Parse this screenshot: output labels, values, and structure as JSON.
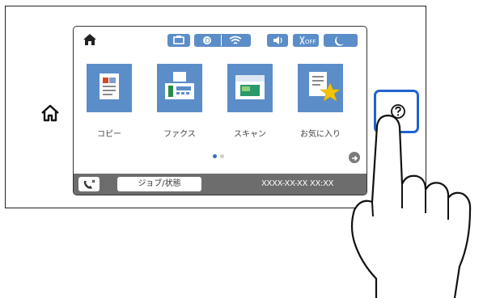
{
  "panel": {
    "home_button_icon": "home-outline-icon",
    "help_button_icon": "question-circle-icon",
    "help_button_highlight_color": "#1f63d2"
  },
  "screen": {
    "status_icons": [
      "home-icon",
      "copy-status-icon",
      "wifi-direct-icon",
      "wifi-icon",
      "volume-icon",
      "eco-off-icon",
      "sleep-icon"
    ],
    "tiles": [
      {
        "label": "コピー",
        "icon": "copy-icon"
      },
      {
        "label": "ファクス",
        "icon": "fax-icon"
      },
      {
        "label": "スキャン",
        "icon": "scan-icon"
      },
      {
        "label": "お気に入り",
        "icon": "favorites-star-icon"
      }
    ],
    "page_dots": {
      "current": 1,
      "total": 2
    },
    "bottom_bar": {
      "job_status_label": "ジョブ/状態",
      "datetime": "XXXX-XX-XX XX:XX"
    },
    "accent_color": "#5b8dc9"
  }
}
